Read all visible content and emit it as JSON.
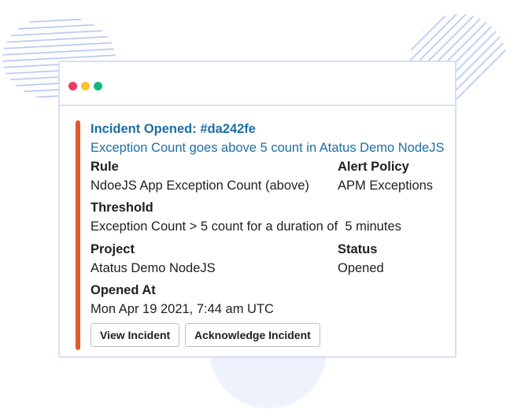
{
  "colors": {
    "accent_bar": "#e05a2b",
    "link_blue": "#1d6fa5",
    "window_border": "#d6dff5",
    "dot_red": "#f03a5f",
    "dot_yellow": "#f5c431",
    "dot_green": "#14b87c",
    "deco_blue": "#b7c6f2"
  },
  "window": {
    "controls": [
      "close-dot",
      "minimize-dot",
      "maximize-dot"
    ]
  },
  "incident": {
    "title": "Incident Opened: #da242fe",
    "subtitle": "Exception Count goes above 5 count in Atatus Demo NodeJS",
    "fields": {
      "rule_label": "Rule",
      "rule_value": "NdoeJS App Exception Count (above)",
      "alert_policy_label": "Alert Policy",
      "alert_policy_value": "APM Exceptions",
      "threshold_label": "Threshold",
      "threshold_value": "Exception Count > 5 count for a duration of  5 minutes",
      "project_label": "Project",
      "project_value": "Atatus Demo NodeJS",
      "status_label": "Status",
      "status_value": "Opened",
      "opened_at_label": "Opened At",
      "opened_at_value": "Mon Apr 19 2021, 7:44 am UTC"
    },
    "buttons": {
      "view": "View Incident",
      "acknowledge": "Acknowledge Incident"
    }
  }
}
